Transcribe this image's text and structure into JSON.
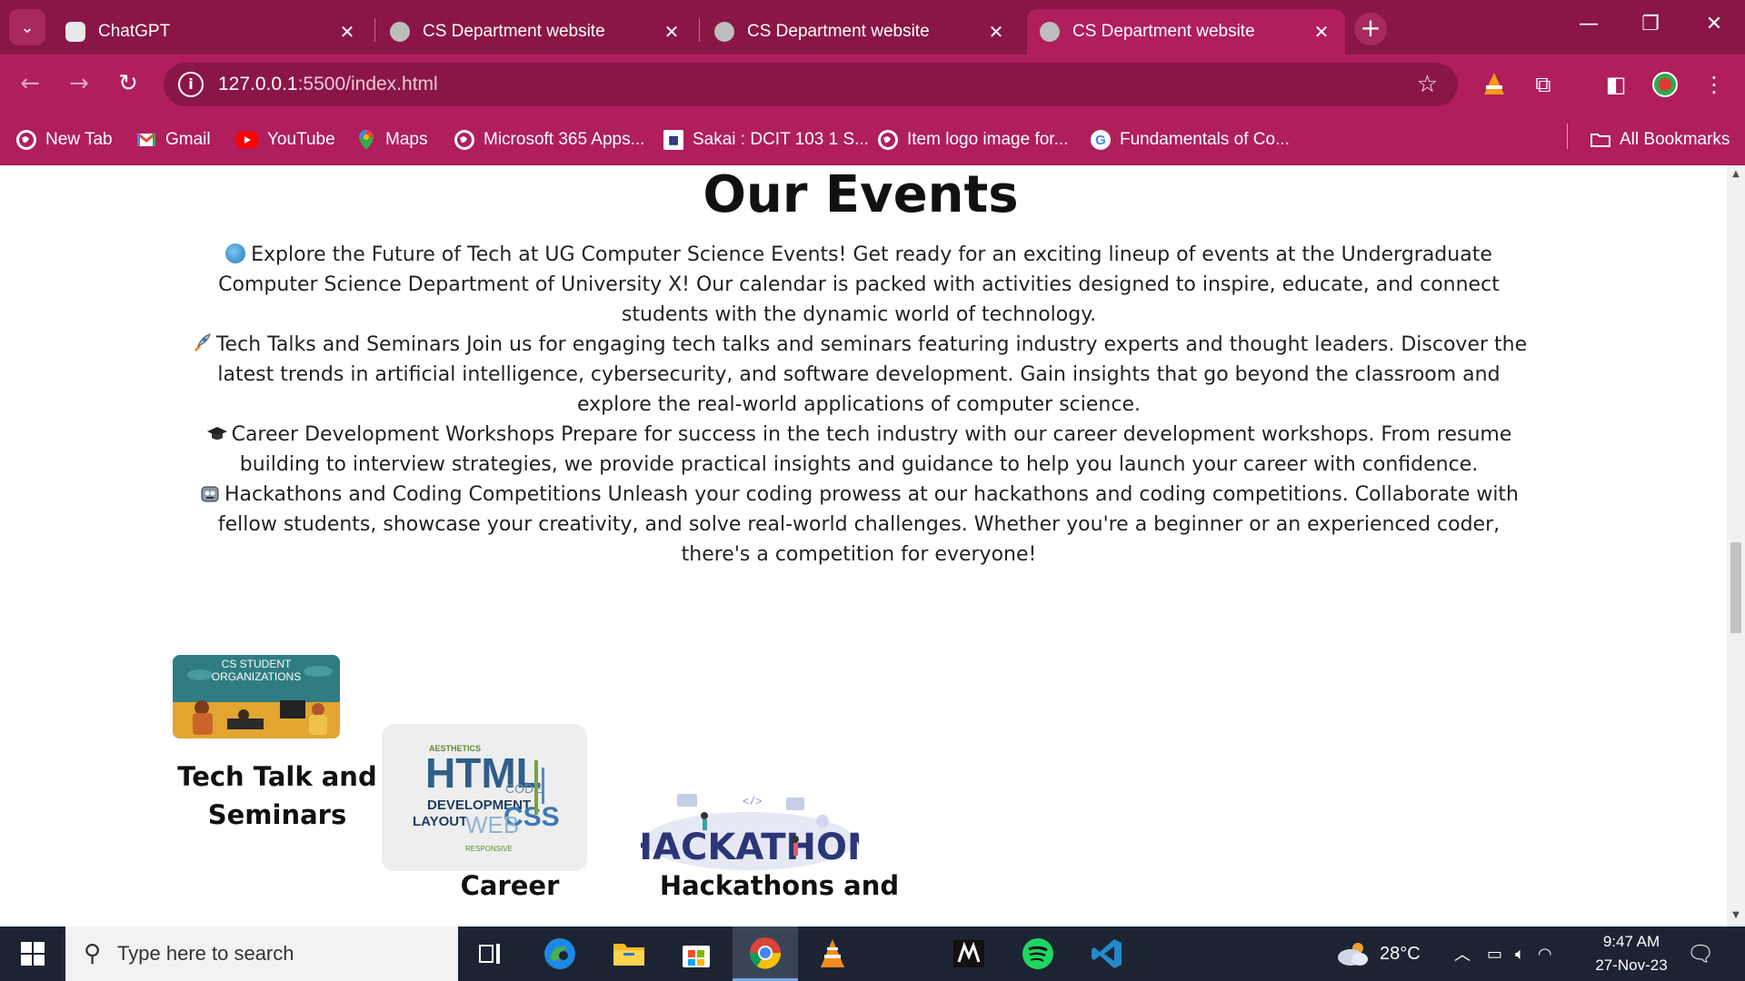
{
  "browser": {
    "tabs": [
      {
        "title": "ChatGPT",
        "active": false
      },
      {
        "title": "CS Department website",
        "active": false
      },
      {
        "title": "CS Department website",
        "active": false
      },
      {
        "title": "CS Department website",
        "active": true
      }
    ],
    "url_host": "127.0.0.1",
    "url_path": ":5500/index.html",
    "bookmarks": [
      {
        "label": "New Tab",
        "icon": "globe-icon"
      },
      {
        "label": "Gmail",
        "icon": "gmail-icon"
      },
      {
        "label": "YouTube",
        "icon": "youtube-icon"
      },
      {
        "label": "Maps",
        "icon": "maps-icon"
      },
      {
        "label": "Microsoft 365 Apps...",
        "icon": "globe-icon"
      },
      {
        "label": "Sakai : DCIT 103 1 S...",
        "icon": "sakai-icon"
      },
      {
        "label": "Item logo image for...",
        "icon": "globe-icon"
      },
      {
        "label": "Fundamentals of Co...",
        "icon": "google-icon"
      }
    ],
    "all_bookmarks": "All Bookmarks",
    "accent_color": "#b01e5c",
    "frame_color": "#8a1646"
  },
  "page": {
    "heading": "Our Events",
    "paragraphs": [
      {
        "icon": "globe-emoji",
        "text": "Explore the Future of Tech at UG Computer Science Events! Get ready for an exciting lineup of events at the Undergraduate Computer Science Department of University X! Our calendar is packed with activities designed to inspire, educate, and connect students with the dynamic world of technology."
      },
      {
        "icon": "rocket-emoji",
        "text": "Tech Talks and Seminars Join us for engaging tech talks and seminars featuring industry experts and thought leaders. Discover the latest trends in artificial intelligence, cybersecurity, and software development. Gain insights that go beyond the classroom and explore the real-world applications of computer science."
      },
      {
        "icon": "graduation-cap-emoji",
        "text": "Career Development Workshops Prepare for success in the tech industry with our career development workshops. From resume building to interview strategies, we provide practical insights and guidance to help you launch your career with confidence."
      },
      {
        "icon": "robot-emoji",
        "text": "Hackathons and Coding Competitions Unleash your coding prowess at our hackathons and coding competitions. Collaborate with fellow students, showcase your creativity, and solve real-world challenges. Whether you're a beginner or an experienced coder, there's a competition for everyone!"
      }
    ],
    "cards": [
      {
        "image_text": "CS STUDENT ORGANIZATIONS",
        "title_line1": "Tech Talk and",
        "title_line2": "Seminars"
      },
      {
        "image_text": "HTML",
        "title_line1": "Career",
        "title_line2": ""
      },
      {
        "image_text": "HACKATHON",
        "title_line1": "Hackathons and",
        "title_line2": ""
      }
    ],
    "word_cloud": [
      "AESTHETICS",
      "HTML",
      "DEVELOPMENT",
      "CSS",
      "LAYOUT",
      "WEB",
      "CODE",
      "RESPONSIVE"
    ]
  },
  "taskbar": {
    "search_placeholder": "Type here to search",
    "weather": "28°C",
    "time": "9:47 AM",
    "date": "27-Nov-23"
  }
}
